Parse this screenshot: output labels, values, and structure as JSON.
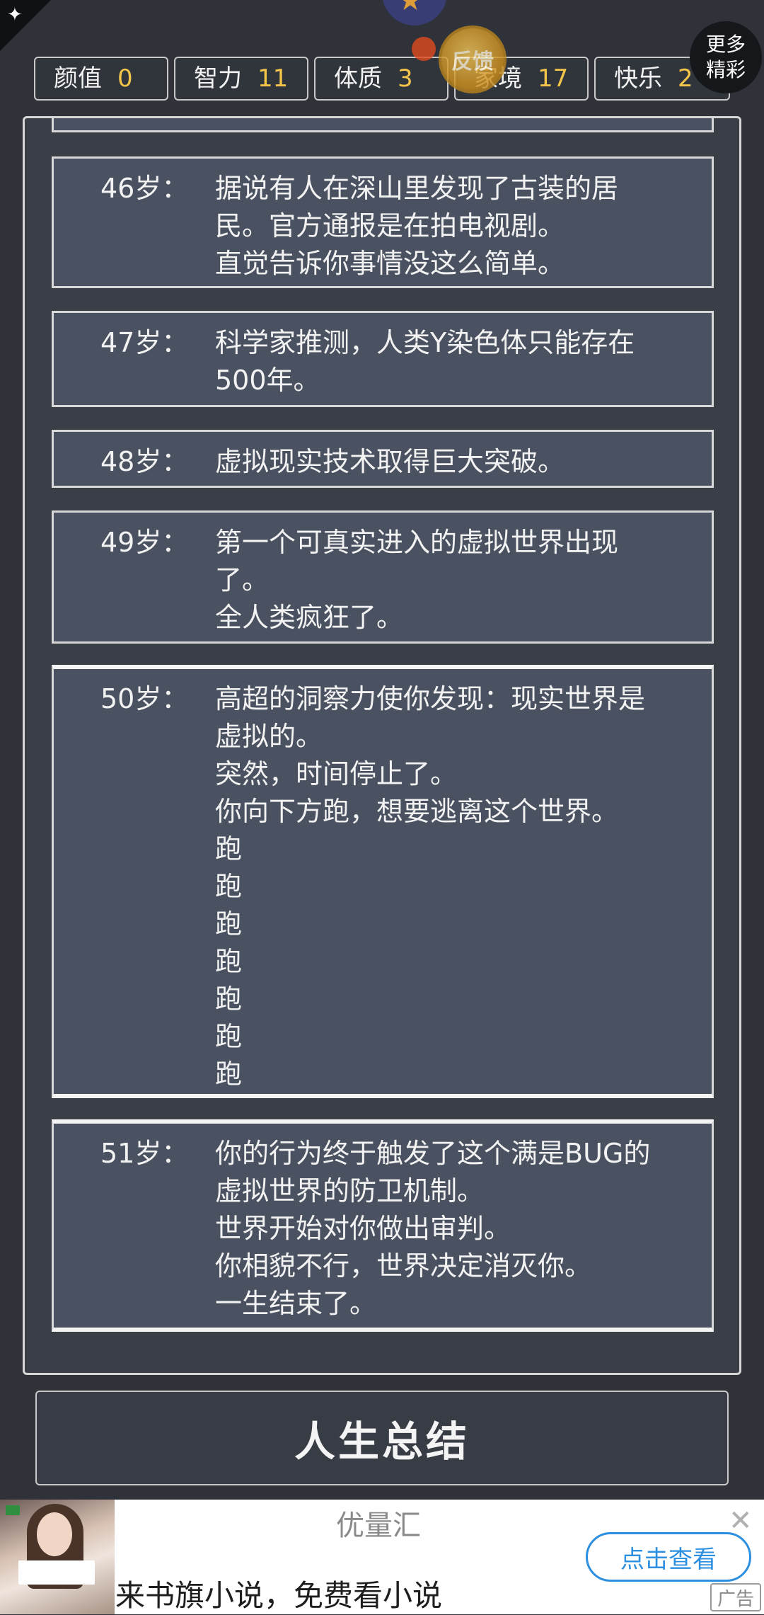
{
  "stats": [
    {
      "label": "颜值",
      "value": "0"
    },
    {
      "label": "智力",
      "value": "11"
    },
    {
      "label": "体质",
      "value": "3"
    },
    {
      "label": "家境",
      "value": "17"
    },
    {
      "label": "快乐",
      "value": "2"
    }
  ],
  "floating": {
    "feedback_label": "反馈",
    "more_line1": "更多",
    "more_line2": "精彩"
  },
  "entries": [
    {
      "age": "46岁：",
      "lines": [
        "据说有人在深山里发现了古装的居",
        "民。官方通报是在拍电视剧。",
        "直觉告诉你事情没这么简单。"
      ]
    },
    {
      "age": "47岁：",
      "lines": [
        "科学家推测，人类Y染色体只能存在",
        "500年。"
      ]
    },
    {
      "age": "48岁：",
      "lines": [
        "虚拟现实技术取得巨大突破。"
      ]
    },
    {
      "age": "49岁：",
      "lines": [
        "第一个可真实进入的虚拟世界出现",
        "了。",
        "全人类疯狂了。"
      ]
    },
    {
      "age": "50岁：",
      "lines": [
        "高超的洞察力使你发现：现实世界是",
        "虚拟的。",
        "突然，时间停止了。",
        "你向下方跑，想要逃离这个世界。",
        "跑",
        "跑",
        "跑",
        "跑",
        "跑",
        "跑",
        "跑"
      ]
    },
    {
      "age": "51岁：",
      "lines": [
        "你的行为终于触发了这个满是BUG的",
        "虚拟世界的防卫机制。",
        "世界开始对你做出审判。",
        "你相貌不行，世界决定消灭你。",
        "一生结束了。"
      ]
    }
  ],
  "summary_button": "人生总结",
  "ad": {
    "title": "优量汇",
    "description": "来书旗小说，免费看小说",
    "cta": "点击查看",
    "label": "广告",
    "close": "✕"
  }
}
